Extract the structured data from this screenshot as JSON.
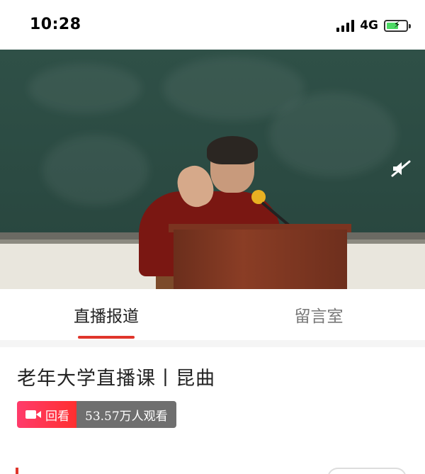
{
  "status_bar": {
    "time": "10:28",
    "network": "4G",
    "battery_percent": 50
  },
  "video": {
    "mute_icon": "muted-speaker-icon"
  },
  "tabs": [
    {
      "label": "直播报道",
      "active": true
    },
    {
      "label": "留言室",
      "active": false
    }
  ],
  "live": {
    "title": "老年大学直播课丨昆曲",
    "replay_label": "回看",
    "views": "53.57万人观看"
  },
  "colors": {
    "accent_red": "#e0352b",
    "badge_pink": "#ff3b6b",
    "badge_gray": "#6f6f6f"
  }
}
